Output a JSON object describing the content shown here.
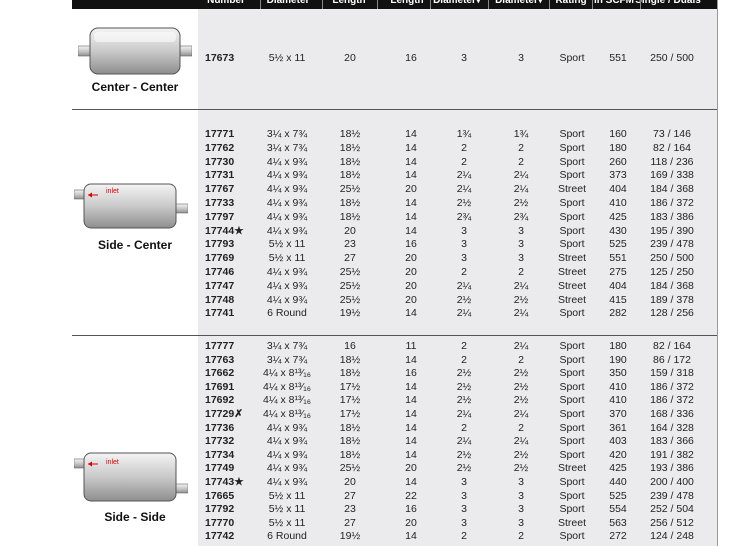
{
  "columns": [
    "Number",
    "Diameter",
    "Length",
    "Length",
    "Diameter▾",
    "Diameter▾",
    "Rating",
    "in SCFM",
    "Single / Duals"
  ],
  "sections": [
    {
      "label": "Center - Center",
      "rows": [
        [
          "17673",
          "5½ x 11",
          "20",
          "16",
          "3",
          "3",
          "Sport",
          "551",
          "250 / 500"
        ]
      ]
    },
    {
      "label": "Side - Center",
      "inlet_label": "inlet",
      "rows": [
        [
          "17771",
          "3¼ x 7¾",
          "18½",
          "14",
          "1¾",
          "1¾",
          "Sport",
          "160",
          "73 / 146"
        ],
        [
          "17762",
          "3¼ x 7¾",
          "18½",
          "14",
          "2",
          "2",
          "Sport",
          "180",
          "82 / 164"
        ],
        [
          "17730",
          "4¼ x 9¾",
          "18½",
          "14",
          "2",
          "2",
          "Sport",
          "260",
          "118 / 236"
        ],
        [
          "17731",
          "4¼ x 9¾",
          "18½",
          "14",
          "2¼",
          "2¼",
          "Sport",
          "373",
          "169 / 338"
        ],
        [
          "17767",
          "4¼ x 9¾",
          "25½",
          "20",
          "2¼",
          "2¼",
          "Street",
          "404",
          "184 / 368"
        ],
        [
          "17733",
          "4¼ x 9¾",
          "18½",
          "14",
          "2½",
          "2½",
          "Sport",
          "410",
          "186 / 372"
        ],
        [
          "17797",
          "4¼ x 9¾",
          "18½",
          "14",
          "2¾",
          "2¾",
          "Sport",
          "425",
          "183 / 386"
        ],
        [
          "17744★",
          "4¼ x 9¾",
          "20",
          "14",
          "3",
          "3",
          "Sport",
          "430",
          "195 / 390"
        ],
        [
          "17793",
          "5½ x 11",
          "23",
          "16",
          "3",
          "3",
          "Sport",
          "525",
          "239 / 478"
        ],
        [
          "17769",
          "5½ x 11",
          "27",
          "20",
          "3",
          "3",
          "Street",
          "551",
          "250 / 500"
        ],
        [
          "17746",
          "4¼ x 9¾",
          "25½",
          "20",
          "2",
          "2",
          "Street",
          "275",
          "125 / 250"
        ],
        [
          "17747",
          "4¼ x 9¾",
          "25½",
          "20",
          "2¼",
          "2¼",
          "Street",
          "404",
          "184 / 368"
        ],
        [
          "17748",
          "4¼ x 9¾",
          "25½",
          "20",
          "2½",
          "2½",
          "Street",
          "415",
          "189 / 378"
        ],
        [
          "17741",
          "6 Round",
          "19½",
          "14",
          "2¼",
          "2¼",
          "Sport",
          "282",
          "128 / 256"
        ]
      ]
    },
    {
      "label": "Side - Side",
      "inlet_label": "inlet",
      "rows": [
        [
          "17777",
          "3¼ x 7¾",
          "16",
          "11",
          "2",
          "2¼",
          "Sport",
          "180",
          "82 / 164"
        ],
        [
          "17763",
          "3¼ x 7¾",
          "18½",
          "14",
          "2",
          "2",
          "Sport",
          "190",
          "86 / 172"
        ],
        [
          "17662",
          "4¼ x 8¹³⁄₁₆",
          "18½",
          "16",
          "2½",
          "2½",
          "Sport",
          "350",
          "159 / 318"
        ],
        [
          "17691",
          "4¼ x 8¹³⁄₁₆",
          "17½",
          "14",
          "2½",
          "2½",
          "Sport",
          "410",
          "186 / 372"
        ],
        [
          "17692",
          "4¼ x 8¹³⁄₁₆",
          "17½",
          "14",
          "2½",
          "2½",
          "Sport",
          "410",
          "186 / 372"
        ],
        [
          "17729✗",
          "4¼ x 8¹³⁄₁₆",
          "17½",
          "14",
          "2¼",
          "2¼",
          "Sport",
          "370",
          "168 / 336"
        ],
        [
          "17736",
          "4¼ x 9¾",
          "18½",
          "14",
          "2",
          "2",
          "Sport",
          "361",
          "164 / 328"
        ],
        [
          "17732",
          "4¼ x 9¾",
          "18½",
          "14",
          "2¼",
          "2¼",
          "Sport",
          "403",
          "183 / 366"
        ],
        [
          "17734",
          "4¼ x 9¾",
          "18½",
          "14",
          "2½",
          "2½",
          "Sport",
          "420",
          "191 / 382"
        ],
        [
          "17749",
          "4¼ x 9¾",
          "25½",
          "20",
          "2½",
          "2½",
          "Street",
          "425",
          "193 / 386"
        ],
        [
          "17743★",
          "4¼ x 9¾",
          "20",
          "14",
          "3",
          "3",
          "Sport",
          "440",
          "200 / 400"
        ],
        [
          "17665",
          "5½ x 11",
          "27",
          "22",
          "3",
          "3",
          "Sport",
          "525",
          "239 / 478"
        ],
        [
          "17792",
          "5½ x 11",
          "23",
          "16",
          "3",
          "3",
          "Sport",
          "554",
          "252 / 504"
        ],
        [
          "17770",
          "5½ x 11",
          "27",
          "20",
          "3",
          "3",
          "Street",
          "563",
          "256 / 512"
        ],
        [
          "17742",
          "6 Round",
          "19½",
          "14",
          "2",
          "2",
          "Sport",
          "272",
          "124 / 248"
        ]
      ]
    }
  ]
}
